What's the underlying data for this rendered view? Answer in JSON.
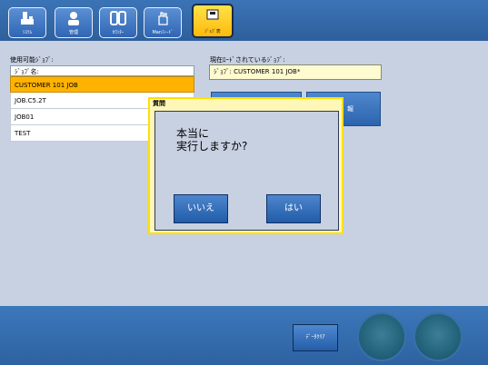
{
  "topbar": {
    "buttons": [
      {
        "label": "ｼｽﾃﾑ",
        "icon": "system-icon"
      },
      {
        "label": "管理",
        "icon": "user-icon"
      },
      {
        "label": "ｶｳﾝﾀｰ",
        "icon": "counter-icon"
      },
      {
        "label": "Manﾌｨｰﾄﾞ",
        "icon": "hand-icon"
      },
      {
        "label": "ｼﾞｮﾌﾞ表",
        "icon": "job-icon",
        "active": true
      }
    ]
  },
  "jobs": {
    "available_label": "使用可能ｼﾞｮﾌﾞ:",
    "column_header": "ｼﾞｮﾌﾞ名:",
    "items": [
      "CUSTOMER 101 JOB",
      "JOB.C5.2T",
      "JOB01",
      "TEST"
    ],
    "selected_index": 0
  },
  "loaded": {
    "label": "現在ﾛｰﾄﾞされているｼﾞｮﾌﾞ:",
    "value": "ｼﾞｮﾌﾞ: CUSTOMER 101 JOB*"
  },
  "partial_button_label": "報",
  "dialog": {
    "title": "質問",
    "message_line1": "本当に",
    "message_line2": "実行しますか?",
    "no_label": "いいえ",
    "yes_label": "はい"
  },
  "bottombar": {
    "clear_label": "ﾃﾞｰﾀｸﾘｱ"
  },
  "colors": {
    "topbar": "#2d5f9c",
    "active_button": "#ffc21a",
    "selected_row": "#ffb300",
    "dialog_border": "#ffe000",
    "background": "#c8d1e2"
  }
}
